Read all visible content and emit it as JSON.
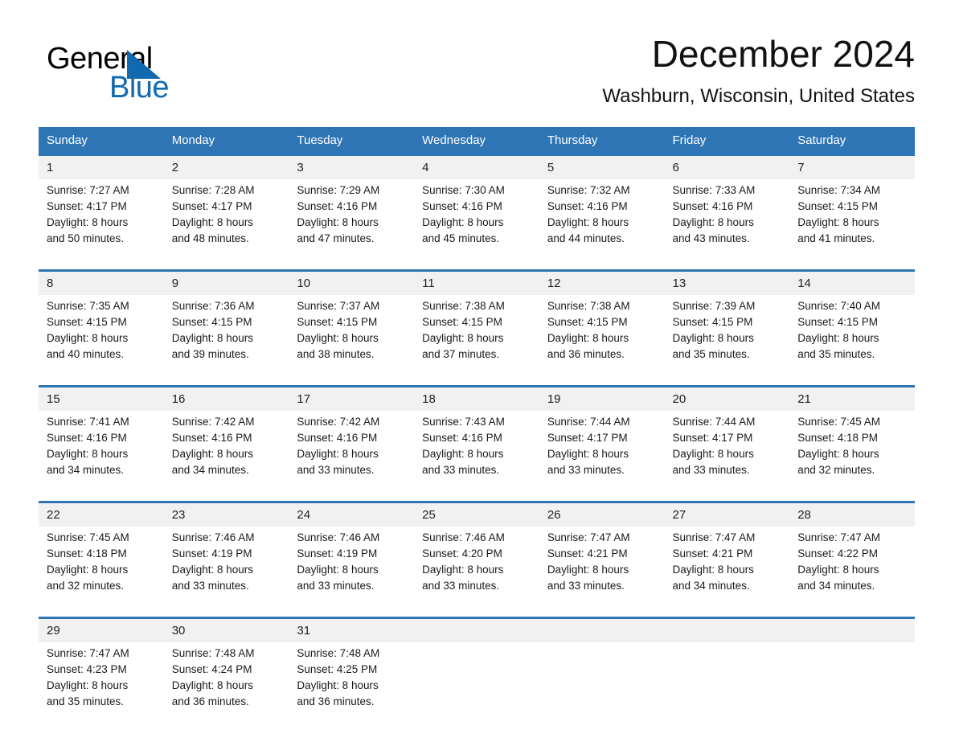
{
  "logo": {
    "word_one": "General",
    "word_two": "Blue",
    "accent_color": "#1169b0",
    "triangle_icon": "triangle-icon"
  },
  "header": {
    "title": "December 2024",
    "subtitle": "Washburn, Wisconsin, United States"
  },
  "theme": {
    "header_blue": "#2e75b6",
    "date_band_gray": "#f1f1f1",
    "text_dark": "#1a1a1a"
  },
  "weekday_headers": [
    "Sunday",
    "Monday",
    "Tuesday",
    "Wednesday",
    "Thursday",
    "Friday",
    "Saturday"
  ],
  "weeks": [
    [
      {
        "day": "1",
        "sunrise": "Sunrise: 7:27 AM",
        "sunset": "Sunset: 4:17 PM",
        "daylight_line1": "Daylight: 8 hours",
        "daylight_line2": "and 50 minutes."
      },
      {
        "day": "2",
        "sunrise": "Sunrise: 7:28 AM",
        "sunset": "Sunset: 4:17 PM",
        "daylight_line1": "Daylight: 8 hours",
        "daylight_line2": "and 48 minutes."
      },
      {
        "day": "3",
        "sunrise": "Sunrise: 7:29 AM",
        "sunset": "Sunset: 4:16 PM",
        "daylight_line1": "Daylight: 8 hours",
        "daylight_line2": "and 47 minutes."
      },
      {
        "day": "4",
        "sunrise": "Sunrise: 7:30 AM",
        "sunset": "Sunset: 4:16 PM",
        "daylight_line1": "Daylight: 8 hours",
        "daylight_line2": "and 45 minutes."
      },
      {
        "day": "5",
        "sunrise": "Sunrise: 7:32 AM",
        "sunset": "Sunset: 4:16 PM",
        "daylight_line1": "Daylight: 8 hours",
        "daylight_line2": "and 44 minutes."
      },
      {
        "day": "6",
        "sunrise": "Sunrise: 7:33 AM",
        "sunset": "Sunset: 4:16 PM",
        "daylight_line1": "Daylight: 8 hours",
        "daylight_line2": "and 43 minutes."
      },
      {
        "day": "7",
        "sunrise": "Sunrise: 7:34 AM",
        "sunset": "Sunset: 4:15 PM",
        "daylight_line1": "Daylight: 8 hours",
        "daylight_line2": "and 41 minutes."
      }
    ],
    [
      {
        "day": "8",
        "sunrise": "Sunrise: 7:35 AM",
        "sunset": "Sunset: 4:15 PM",
        "daylight_line1": "Daylight: 8 hours",
        "daylight_line2": "and 40 minutes."
      },
      {
        "day": "9",
        "sunrise": "Sunrise: 7:36 AM",
        "sunset": "Sunset: 4:15 PM",
        "daylight_line1": "Daylight: 8 hours",
        "daylight_line2": "and 39 minutes."
      },
      {
        "day": "10",
        "sunrise": "Sunrise: 7:37 AM",
        "sunset": "Sunset: 4:15 PM",
        "daylight_line1": "Daylight: 8 hours",
        "daylight_line2": "and 38 minutes."
      },
      {
        "day": "11",
        "sunrise": "Sunrise: 7:38 AM",
        "sunset": "Sunset: 4:15 PM",
        "daylight_line1": "Daylight: 8 hours",
        "daylight_line2": "and 37 minutes."
      },
      {
        "day": "12",
        "sunrise": "Sunrise: 7:38 AM",
        "sunset": "Sunset: 4:15 PM",
        "daylight_line1": "Daylight: 8 hours",
        "daylight_line2": "and 36 minutes."
      },
      {
        "day": "13",
        "sunrise": "Sunrise: 7:39 AM",
        "sunset": "Sunset: 4:15 PM",
        "daylight_line1": "Daylight: 8 hours",
        "daylight_line2": "and 35 minutes."
      },
      {
        "day": "14",
        "sunrise": "Sunrise: 7:40 AM",
        "sunset": "Sunset: 4:15 PM",
        "daylight_line1": "Daylight: 8 hours",
        "daylight_line2": "and 35 minutes."
      }
    ],
    [
      {
        "day": "15",
        "sunrise": "Sunrise: 7:41 AM",
        "sunset": "Sunset: 4:16 PM",
        "daylight_line1": "Daylight: 8 hours",
        "daylight_line2": "and 34 minutes."
      },
      {
        "day": "16",
        "sunrise": "Sunrise: 7:42 AM",
        "sunset": "Sunset: 4:16 PM",
        "daylight_line1": "Daylight: 8 hours",
        "daylight_line2": "and 34 minutes."
      },
      {
        "day": "17",
        "sunrise": "Sunrise: 7:42 AM",
        "sunset": "Sunset: 4:16 PM",
        "daylight_line1": "Daylight: 8 hours",
        "daylight_line2": "and 33 minutes."
      },
      {
        "day": "18",
        "sunrise": "Sunrise: 7:43 AM",
        "sunset": "Sunset: 4:16 PM",
        "daylight_line1": "Daylight: 8 hours",
        "daylight_line2": "and 33 minutes."
      },
      {
        "day": "19",
        "sunrise": "Sunrise: 7:44 AM",
        "sunset": "Sunset: 4:17 PM",
        "daylight_line1": "Daylight: 8 hours",
        "daylight_line2": "and 33 minutes."
      },
      {
        "day": "20",
        "sunrise": "Sunrise: 7:44 AM",
        "sunset": "Sunset: 4:17 PM",
        "daylight_line1": "Daylight: 8 hours",
        "daylight_line2": "and 33 minutes."
      },
      {
        "day": "21",
        "sunrise": "Sunrise: 7:45 AM",
        "sunset": "Sunset: 4:18 PM",
        "daylight_line1": "Daylight: 8 hours",
        "daylight_line2": "and 32 minutes."
      }
    ],
    [
      {
        "day": "22",
        "sunrise": "Sunrise: 7:45 AM",
        "sunset": "Sunset: 4:18 PM",
        "daylight_line1": "Daylight: 8 hours",
        "daylight_line2": "and 32 minutes."
      },
      {
        "day": "23",
        "sunrise": "Sunrise: 7:46 AM",
        "sunset": "Sunset: 4:19 PM",
        "daylight_line1": "Daylight: 8 hours",
        "daylight_line2": "and 33 minutes."
      },
      {
        "day": "24",
        "sunrise": "Sunrise: 7:46 AM",
        "sunset": "Sunset: 4:19 PM",
        "daylight_line1": "Daylight: 8 hours",
        "daylight_line2": "and 33 minutes."
      },
      {
        "day": "25",
        "sunrise": "Sunrise: 7:46 AM",
        "sunset": "Sunset: 4:20 PM",
        "daylight_line1": "Daylight: 8 hours",
        "daylight_line2": "and 33 minutes."
      },
      {
        "day": "26",
        "sunrise": "Sunrise: 7:47 AM",
        "sunset": "Sunset: 4:21 PM",
        "daylight_line1": "Daylight: 8 hours",
        "daylight_line2": "and 33 minutes."
      },
      {
        "day": "27",
        "sunrise": "Sunrise: 7:47 AM",
        "sunset": "Sunset: 4:21 PM",
        "daylight_line1": "Daylight: 8 hours",
        "daylight_line2": "and 34 minutes."
      },
      {
        "day": "28",
        "sunrise": "Sunrise: 7:47 AM",
        "sunset": "Sunset: 4:22 PM",
        "daylight_line1": "Daylight: 8 hours",
        "daylight_line2": "and 34 minutes."
      }
    ],
    [
      {
        "day": "29",
        "sunrise": "Sunrise: 7:47 AM",
        "sunset": "Sunset: 4:23 PM",
        "daylight_line1": "Daylight: 8 hours",
        "daylight_line2": "and 35 minutes."
      },
      {
        "day": "30",
        "sunrise": "Sunrise: 7:48 AM",
        "sunset": "Sunset: 4:24 PM",
        "daylight_line1": "Daylight: 8 hours",
        "daylight_line2": "and 36 minutes."
      },
      {
        "day": "31",
        "sunrise": "Sunrise: 7:48 AM",
        "sunset": "Sunset: 4:25 PM",
        "daylight_line1": "Daylight: 8 hours",
        "daylight_line2": "and 36 minutes."
      },
      {
        "day": "",
        "sunrise": "",
        "sunset": "",
        "daylight_line1": "",
        "daylight_line2": ""
      },
      {
        "day": "",
        "sunrise": "",
        "sunset": "",
        "daylight_line1": "",
        "daylight_line2": ""
      },
      {
        "day": "",
        "sunrise": "",
        "sunset": "",
        "daylight_line1": "",
        "daylight_line2": ""
      },
      {
        "day": "",
        "sunrise": "",
        "sunset": "",
        "daylight_line1": "",
        "daylight_line2": ""
      }
    ]
  ]
}
